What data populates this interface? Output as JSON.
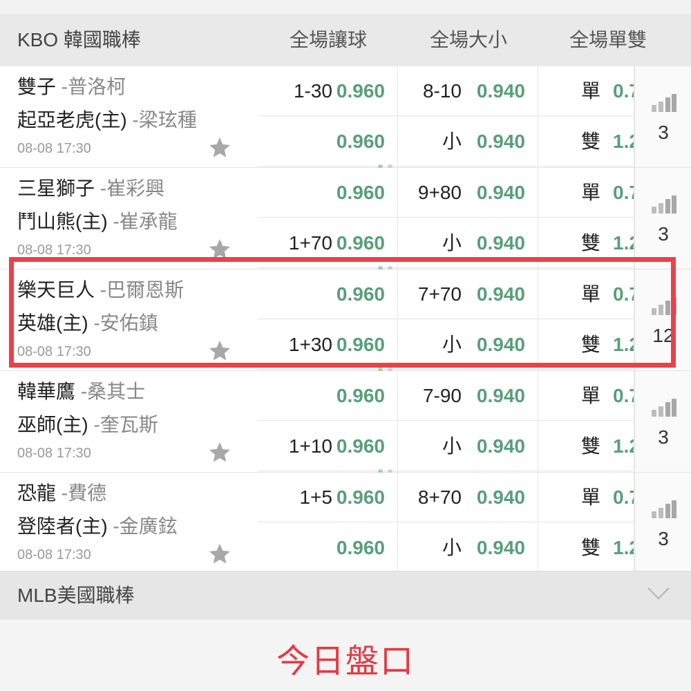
{
  "header": {
    "league": "KBO 韓國職棒",
    "col_handicap": "全場讓球",
    "col_total": "全場大小",
    "col_oddeven": "全場單雙"
  },
  "matches": [
    {
      "away": "雙子",
      "away_pitcher": "-普洛柯",
      "home": "起亞老虎(主)",
      "home_pitcher": "-梁玹種",
      "time": "08-08 17:30",
      "hcp1_line": "1-30",
      "hcp1_odd": "0.960",
      "hcp2_line": "",
      "hcp2_odd": "0.960",
      "tot1_line": "8-10",
      "tot1_odd": "0.940",
      "tot2_line": "小",
      "tot2_odd": "0.940",
      "oe1_line": "單",
      "oe1_odd": "0.7",
      "oe2_line": "雙",
      "oe2_odd": "1.2",
      "count": "3"
    },
    {
      "away": "三星獅子",
      "away_pitcher": "-崔彩興",
      "home": "鬥山熊(主)",
      "home_pitcher": "-崔承龍",
      "time": "08-08 17:30",
      "hcp1_line": "",
      "hcp1_odd": "0.960",
      "hcp2_line": "1+70",
      "hcp2_odd": "0.960",
      "tot1_line": "9+80",
      "tot1_odd": "0.940",
      "tot2_line": "小",
      "tot2_odd": "0.940",
      "oe1_line": "單",
      "oe1_odd": "0.7",
      "oe2_line": "雙",
      "oe2_odd": "1.2",
      "count": "3"
    },
    {
      "away": "樂天巨人",
      "away_pitcher": "-巴爾恩斯",
      "home": "英雄(主)",
      "home_pitcher": "-安佑鎮",
      "time": "08-08 17:30",
      "hcp1_line": "",
      "hcp1_odd": "0.960",
      "hcp2_line": "1+30",
      "hcp2_odd": "0.960",
      "tot1_line": "7+70",
      "tot1_odd": "0.940",
      "tot2_line": "小",
      "tot2_odd": "0.940",
      "oe1_line": "單",
      "oe1_odd": "0.7",
      "oe2_line": "雙",
      "oe2_odd": "1.2",
      "count": "12"
    },
    {
      "away": "韓華鷹",
      "away_pitcher": "-桑其士",
      "home": "巫師(主)",
      "home_pitcher": "-奎瓦斯",
      "time": "08-08 17:30",
      "hcp1_line": "",
      "hcp1_odd": "0.960",
      "hcp2_line": "1+10",
      "hcp2_odd": "0.960",
      "tot1_line": "7-90",
      "tot1_odd": "0.940",
      "tot2_line": "小",
      "tot2_odd": "0.940",
      "oe1_line": "單",
      "oe1_odd": "0.7",
      "oe2_line": "雙",
      "oe2_odd": "1.2",
      "count": "3"
    },
    {
      "away": "恐龍",
      "away_pitcher": "-費德",
      "home": "登陸者(主)",
      "home_pitcher": "-金廣鉉",
      "time": "08-08 17:30",
      "hcp1_line": "1+5",
      "hcp1_odd": "0.960",
      "hcp2_line": "",
      "hcp2_odd": "0.960",
      "tot1_line": "8+70",
      "tot1_odd": "0.940",
      "tot2_line": "小",
      "tot2_odd": "0.940",
      "oe1_line": "單",
      "oe1_odd": "0.7",
      "oe2_line": "雙",
      "oe2_odd": "1.2",
      "count": "3"
    }
  ],
  "mlb": {
    "label": "MLB美國職棒"
  },
  "caption": "今日盤口",
  "colors": {
    "odds_green": "#5a9e7c",
    "highlight_red": "#e8424d",
    "caption_red": "#e23b45"
  },
  "icons": {
    "favorite": "star-icon",
    "stats": "signal-bars-icon",
    "expand": "chevron-down-icon"
  }
}
